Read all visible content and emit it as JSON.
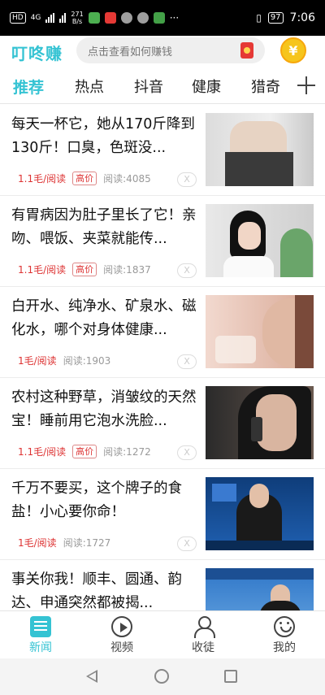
{
  "status_bar": {
    "carrier_badge": "HD",
    "network": "4G",
    "speed_value": "271",
    "speed_unit": "B/s",
    "battery": "97",
    "time": "7:06"
  },
  "header": {
    "logo": "叮咚赚",
    "search_placeholder": "点击查看如何赚钱",
    "coin_symbol": "¥"
  },
  "tabs": [
    {
      "label": "推荐",
      "active": true
    },
    {
      "label": "热点",
      "active": false
    },
    {
      "label": "抖音",
      "active": false
    },
    {
      "label": "健康",
      "active": false
    },
    {
      "label": "猎奇",
      "active": false
    }
  ],
  "feed": [
    {
      "title": "每天一杯它，她从170斤降到130斤！口臭，色斑没...",
      "price": "1.1毛/阅读",
      "hot": "高价",
      "reads": "阅读:4085",
      "close": "X"
    },
    {
      "title": "有胃病因为肚子里长了它！亲吻、喂饭、夹菜就能传...",
      "price": "1.1毛/阅读",
      "hot": "高价",
      "reads": "阅读:1837",
      "close": "X"
    },
    {
      "title": "白开水、纯净水、矿泉水、磁化水，哪个对身体健康...",
      "price": "1毛/阅读",
      "hot": "",
      "reads": "阅读:1903",
      "close": "X"
    },
    {
      "title": "农村这种野草，消皱纹的天然宝！睡前用它泡水洗脸...",
      "price": "1.1毛/阅读",
      "hot": "高价",
      "reads": "阅读:1272",
      "close": "X"
    },
    {
      "title": "千万不要买，这个牌子的食盐！小心要你命！",
      "price": "1毛/阅读",
      "hot": "",
      "reads": "阅读:1727",
      "close": "X"
    },
    {
      "title": "事关你我！顺丰、圆通、韵达、申通突然都被揭...",
      "price": "",
      "hot": "",
      "reads": "",
      "close": ""
    }
  ],
  "bottom_nav": [
    {
      "label": "新闻",
      "icon": "news-icon",
      "active": true
    },
    {
      "label": "视频",
      "icon": "video-icon",
      "active": false
    },
    {
      "label": "收徒",
      "icon": "users-icon",
      "active": false
    },
    {
      "label": "我的",
      "icon": "me-icon",
      "active": false
    }
  ],
  "colors": {
    "accent": "#35c3d3",
    "price": "#dd3333",
    "coin": "#f6c51c"
  }
}
